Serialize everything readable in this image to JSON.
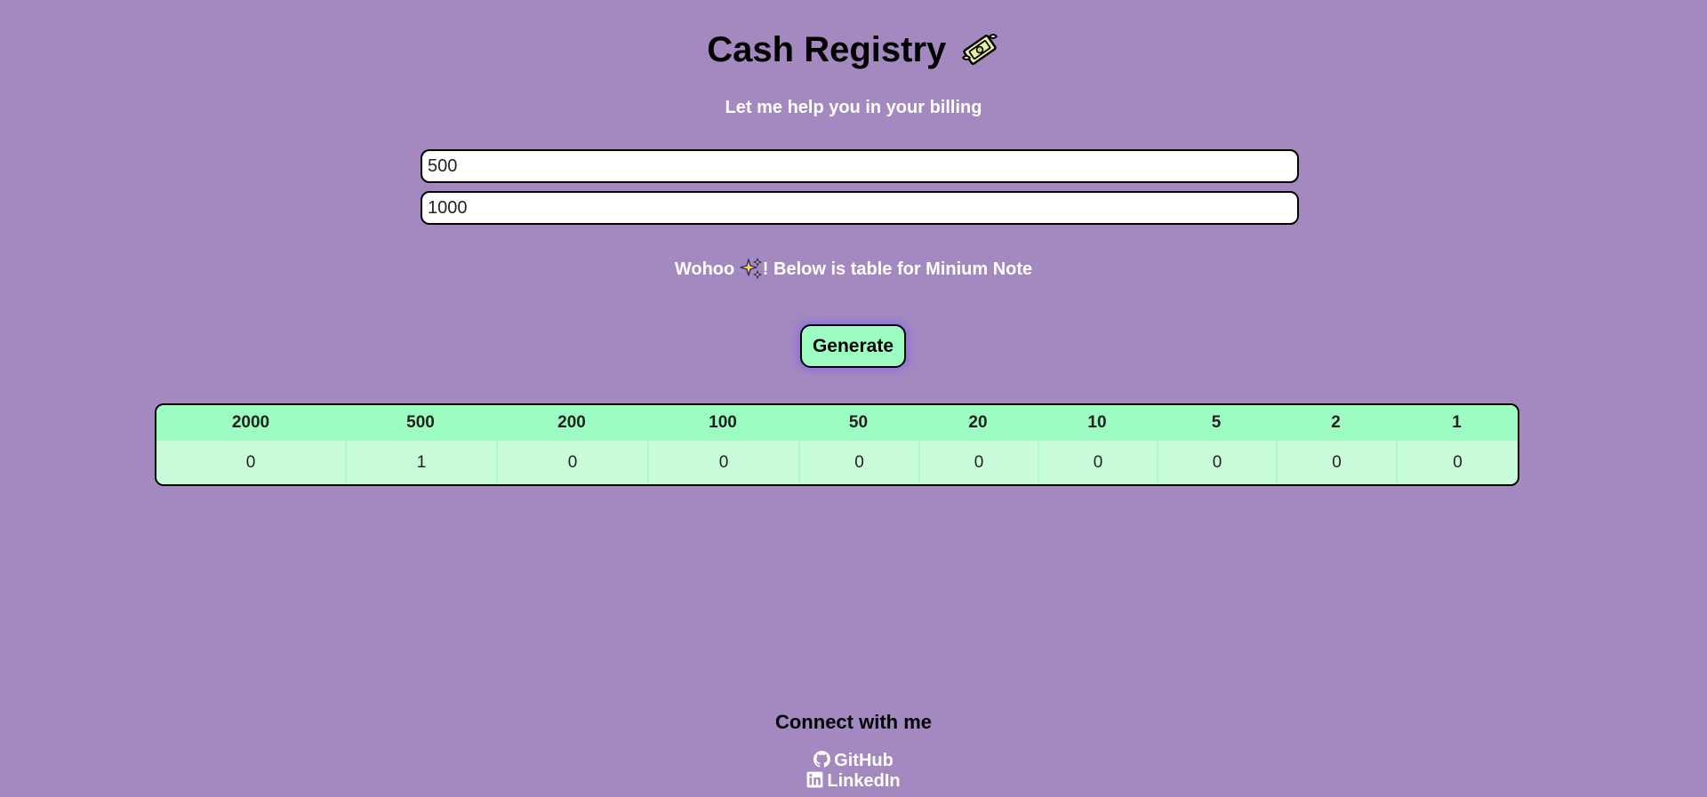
{
  "header": {
    "title": "Cash Registry",
    "title_icon": "money-with-wings-icon",
    "subtitle": "Let me help you in your billing"
  },
  "form": {
    "bill_amount": "500",
    "cash_given": "1000"
  },
  "message": {
    "prefix": "Wohoo",
    "icon": "sparkles-icon",
    "suffix": "! Below is table for Minium Note"
  },
  "generate_label": "Generate",
  "notes_table": {
    "headers": [
      "2000",
      "500",
      "200",
      "100",
      "50",
      "20",
      "10",
      "5",
      "2",
      "1"
    ],
    "counts": [
      "0",
      "1",
      "0",
      "0",
      "0",
      "0",
      "0",
      "0",
      "0",
      "0"
    ]
  },
  "footer": {
    "heading": "Connect with me",
    "github": "GitHub",
    "linkedin": "LinkedIn"
  },
  "colors": {
    "background": "#a389c0",
    "accent": "#9dfcc2",
    "table_cell": "#c9fcdb"
  }
}
